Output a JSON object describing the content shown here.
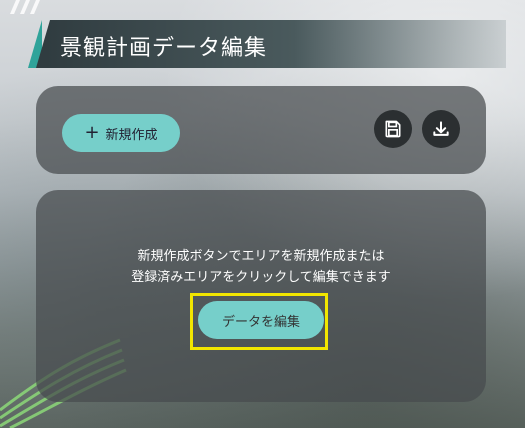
{
  "header": {
    "title": "景観計画データ編集"
  },
  "toolbar": {
    "new_button_label": "新規作成",
    "new_button_icon": "plus-icon",
    "save_icon": "save-icon",
    "download_icon": "download-icon"
  },
  "main": {
    "message_line1": "新規作成ボタンでエリアを新規作成または",
    "message_line2": "登録済みエリアをクリックして編集できます",
    "edit_button_label": "データを編集"
  },
  "colors": {
    "accent": "#76cfca",
    "highlight": "#f2e600",
    "panel": "#464b4e"
  }
}
